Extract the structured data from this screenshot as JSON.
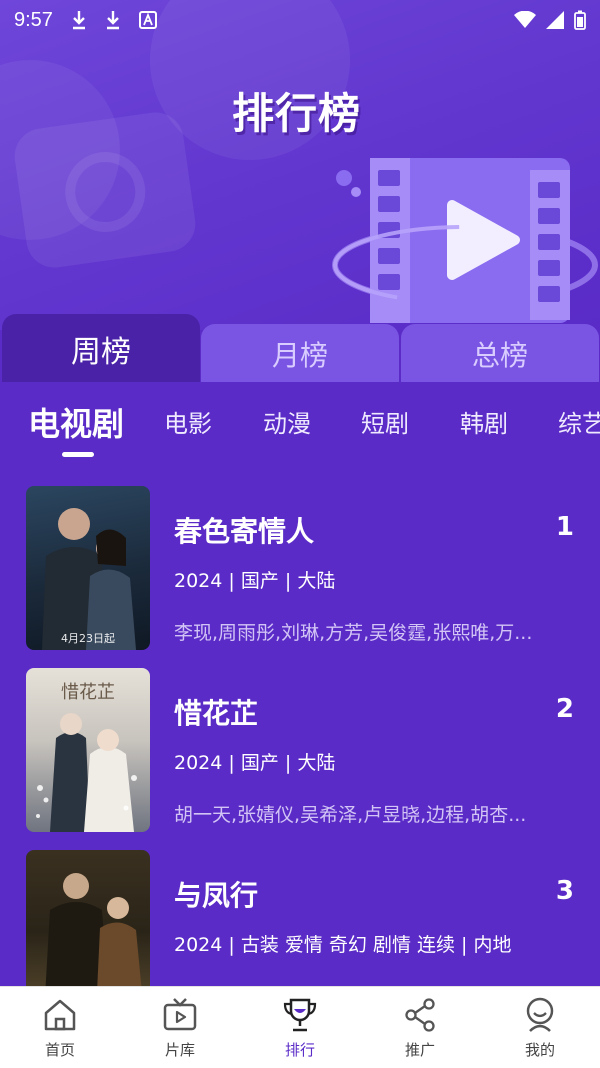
{
  "status_bar": {
    "time": "9:57"
  },
  "banner": {
    "title": "排行榜"
  },
  "period_tabs": [
    {
      "label": "周榜",
      "active": true
    },
    {
      "label": "月榜",
      "active": false
    },
    {
      "label": "总榜",
      "active": false
    }
  ],
  "category_tabs": [
    {
      "label": "电视剧",
      "active": true
    },
    {
      "label": "电影",
      "active": false
    },
    {
      "label": "动漫",
      "active": false
    },
    {
      "label": "短剧",
      "active": false
    },
    {
      "label": "韩剧",
      "active": false
    },
    {
      "label": "综艺",
      "active": false
    }
  ],
  "items": [
    {
      "title": "春色寄情人",
      "rank": "1",
      "meta": "2024 | 国产 | 大陆",
      "cast": "李现,周雨彤,刘琳,方芳,吴俊霆,张熙唯,万...",
      "poster_text": "4月23日起",
      "poster_colors": [
        "#1d2a3a",
        "#3a5068"
      ]
    },
    {
      "title": "惜花芷",
      "rank": "2",
      "meta": "2024 | 国产 | 大陆",
      "cast": "胡一天,张婧仪,吴希泽,卢昱晓,边程,胡杏...",
      "poster_text": "",
      "poster_colors": [
        "#d8d2c8",
        "#8a8f9a"
      ]
    },
    {
      "title": "与凤行",
      "rank": "3",
      "meta": "2024 | 古装 爱情 奇幻 剧情 连续 | 内地",
      "cast": "",
      "poster_text": "",
      "poster_colors": [
        "#2a2418",
        "#6a5a3a"
      ]
    }
  ],
  "bottom_nav": [
    {
      "label": "首页",
      "icon": "home-icon",
      "active": false
    },
    {
      "label": "片库",
      "icon": "tv-icon",
      "active": false
    },
    {
      "label": "排行",
      "icon": "trophy-icon",
      "active": true
    },
    {
      "label": "推广",
      "icon": "share-icon",
      "active": false
    },
    {
      "label": "我的",
      "icon": "profile-icon",
      "active": false
    }
  ],
  "colors": {
    "primary": "#5a2bc7",
    "tab_active": "#4a22a8",
    "tab_inactive": "#7a55e3"
  }
}
